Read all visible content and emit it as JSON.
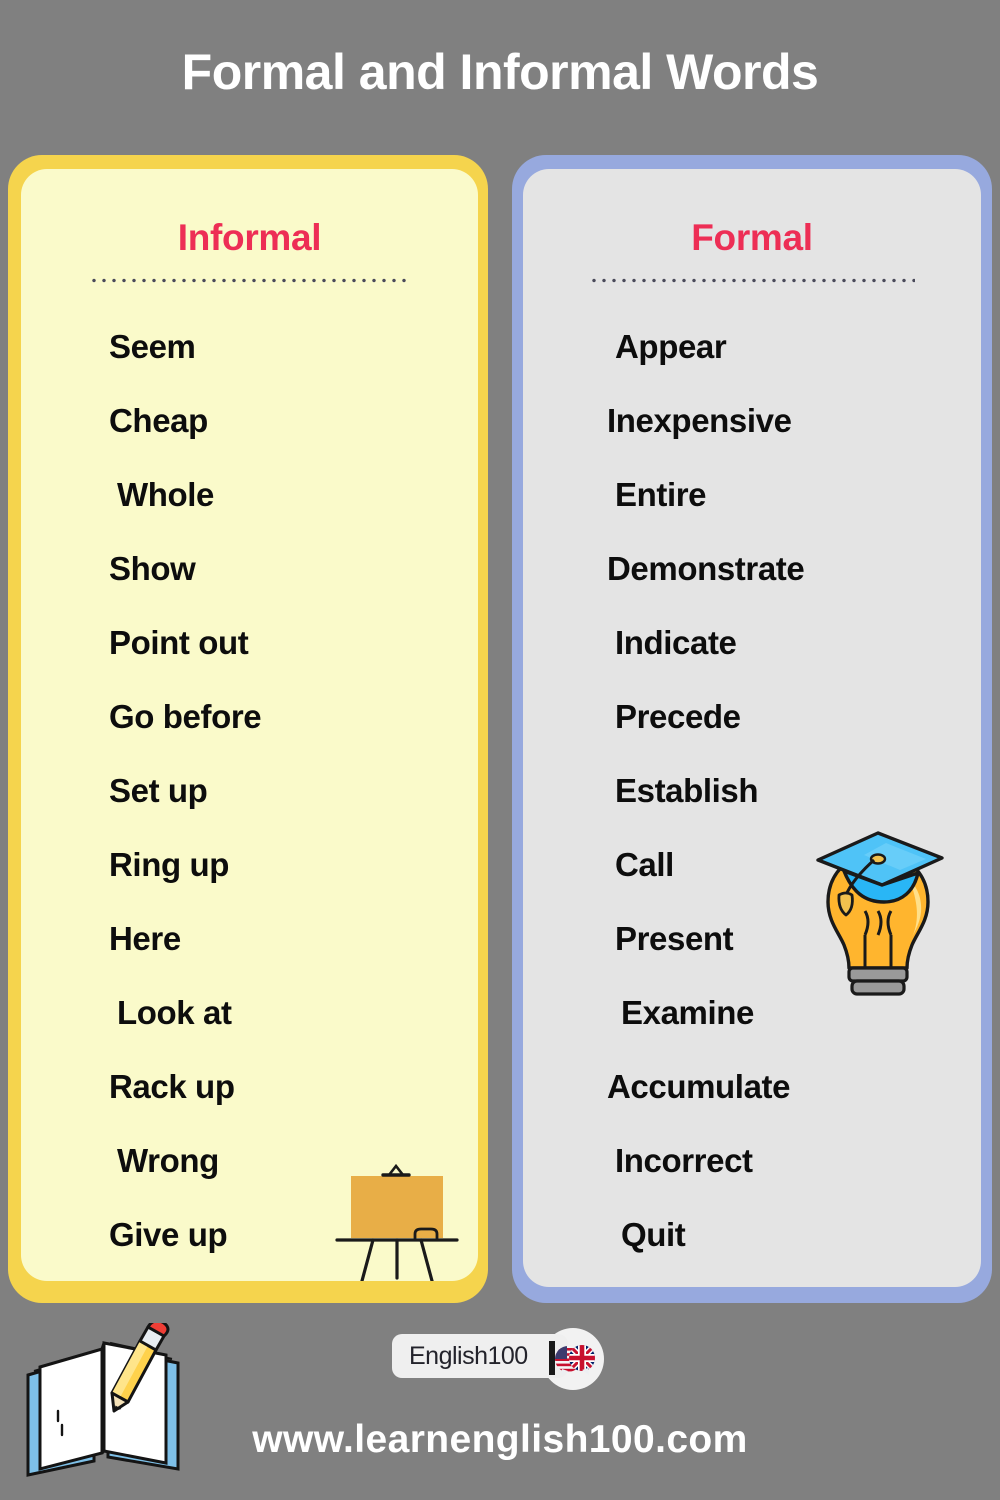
{
  "title": "Formal and Informal Words",
  "colors": {
    "background": "#808080",
    "title_text": "#FFFFFF",
    "heading_accent": "#ED2E55",
    "informal_border": "#F5D44D",
    "informal_fill": "#FAFACA",
    "formal_border": "#97A9DE",
    "formal_fill": "#E4E4E4",
    "word_text": "#0D0D0D",
    "divider_dots": "#4A4A5A"
  },
  "columns": {
    "informal": {
      "heading": "Informal",
      "words": [
        "Seem",
        "Cheap",
        "Whole",
        "Show",
        "Point out",
        "Go before",
        "Set up",
        "Ring up",
        "Here",
        "Look at",
        "Rack up",
        "Wrong",
        "Give up"
      ]
    },
    "formal": {
      "heading": "Formal",
      "words": [
        "Appear",
        "Inexpensive",
        "Entire",
        "Demonstrate",
        "Indicate",
        "Precede",
        "Establish",
        "Call",
        "Present",
        "Examine",
        "Accumulate",
        "Incorrect",
        "Quit"
      ]
    }
  },
  "illustrations": {
    "easel": "easel-board-icon",
    "bulb": "graduation-lightbulb-icon",
    "book": "open-book-pencil-icon"
  },
  "footer": {
    "logo_text": "English100",
    "logo_emblem": "us-uk-flag-bubbles-icon",
    "site_url": "www.learnenglish100.com"
  }
}
